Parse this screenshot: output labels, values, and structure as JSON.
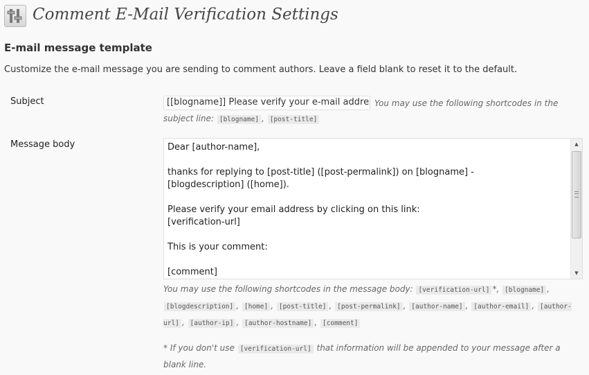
{
  "page": {
    "title": "Comment E-Mail Verification Settings"
  },
  "section": {
    "title": "E-mail message template",
    "description": "Customize the e-mail message you are sending to comment authors. Leave a field blank to reset it to the default."
  },
  "subject": {
    "label": "Subject",
    "value": "[[blogname]] Please verify your e-mail address",
    "desc_line1": "You may use the following shortcodes in the",
    "desc_line2": "subject line:",
    "shortcodes": [
      "[blogname]",
      "[post-title]"
    ]
  },
  "message_body": {
    "label": "Message body",
    "value": "Dear [author-name],\n\nthanks for replying to [post-title] ([post-permalink]) on [blogname] -\n[blogdescription] ([home]).\n\nPlease verify your email address by clicking on this link:\n[verification-url]\n\nThis is your comment:\n\n[comment]",
    "desc_intro": "You may use the following shortcodes in the message body:",
    "shortcodes": [
      "[verification-url]",
      "[blogname]",
      "[blogdescription]",
      "[home]",
      "[post-title]",
      "[post-permalink]",
      "[author-name]",
      "[author-email]",
      "[author-url]",
      "[author-ip]",
      "[author-hostname]",
      "[comment]"
    ],
    "required_marker": "*",
    "footnote_prefix": "* If you don't use",
    "footnote_code": "[verification-url]",
    "footnote_suffix": "that information will be appended to your message after a blank line."
  },
  "icons": {
    "page_icon": "settings-sliders-icon",
    "scroll_up": "arrow-up-icon",
    "scroll_down": "arrow-down-icon"
  }
}
